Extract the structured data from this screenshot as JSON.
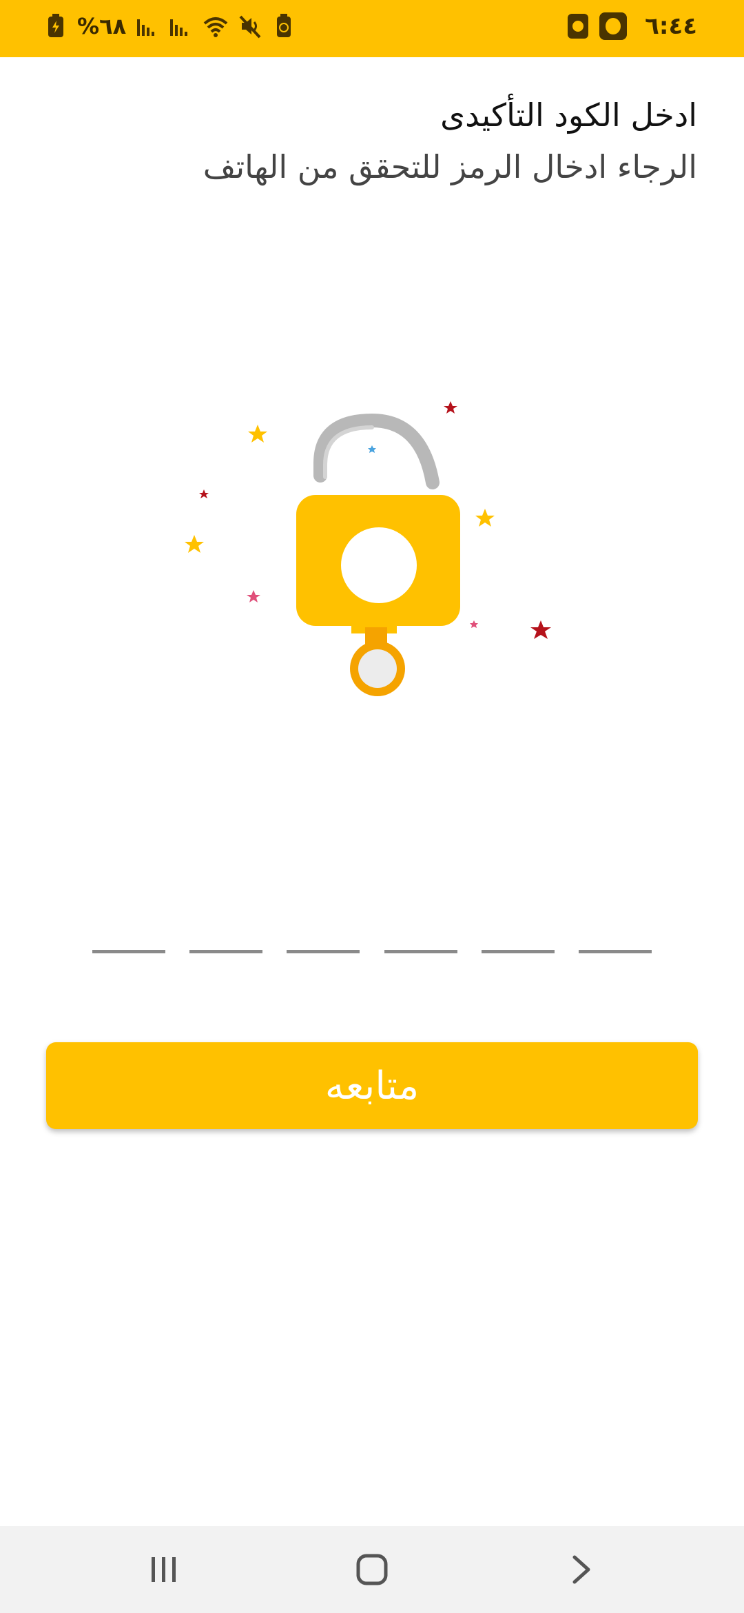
{
  "status_bar": {
    "time": "٦:٤٤",
    "battery_percent": "%٦٨",
    "bg_color": "#FFC100"
  },
  "header": {
    "title": "ادخل الكود التأكيدى",
    "subtitle": "الرجاء ادخال الرمز للتحقق من الهاتف"
  },
  "illustration": {
    "icon": "padlock-key-stars-icon",
    "accent": "#FFC100"
  },
  "code_input": {
    "slots": [
      "",
      "",
      "",
      "",
      "",
      ""
    ]
  },
  "continue_button": {
    "label": "متابعه",
    "color": "#FFC100"
  },
  "nav_bar": {
    "items": [
      "recent-apps",
      "home",
      "back"
    ]
  }
}
